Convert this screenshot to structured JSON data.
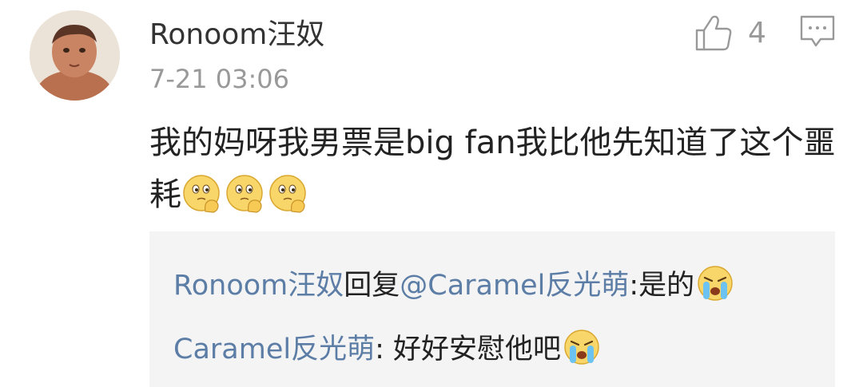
{
  "comment": {
    "username": "Ronoom汪奴",
    "timestamp": "7-21 03:06",
    "like_count": "4",
    "text": "我的妈呀我男票是big fan我比他先知道了这个噩耗",
    "emojis": [
      "thinking-face-emoji",
      "thinking-face-emoji",
      "thinking-face-emoji"
    ]
  },
  "replies": [
    {
      "author": "Ronoom汪奴",
      "action": "回复",
      "mention": "@Caramel反光萌",
      "separator": ":",
      "text": "是的",
      "emoji": "crying-face-emoji"
    },
    {
      "author": "Caramel反光萌",
      "separator": ": ",
      "text": "好好安慰他吧",
      "emoji": "crying-face-emoji"
    }
  ],
  "icons": {
    "like": "thumbs-up-icon",
    "reply": "comment-bubble-icon"
  },
  "colors": {
    "username": "#333333",
    "meta": "#999999",
    "link": "#5c7da6",
    "reply_bg": "#f4f4f4"
  }
}
